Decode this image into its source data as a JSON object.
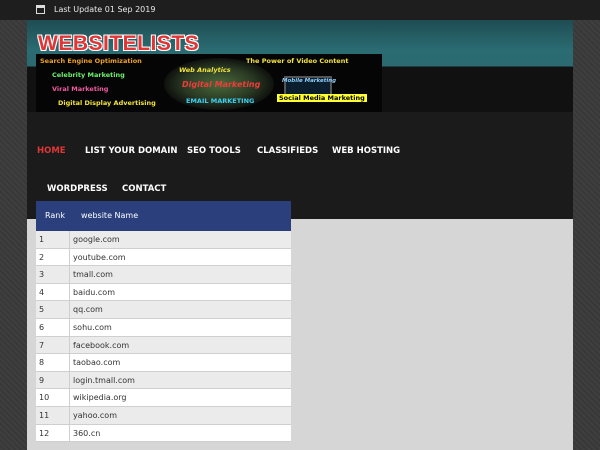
{
  "topbar": {
    "last_update": "Last Update 01 Sep 2019"
  },
  "site": {
    "title": "WEBSITELISTS"
  },
  "banner": {
    "phrases": {
      "seo": "Search Engine Optimization",
      "video": "The Power of Video Content",
      "analytics": "Web Analytics",
      "celebrity": "Celebrity Marketing",
      "digital": "Digital Marketing",
      "mobile": "Mobile Marketing",
      "viral": "Viral Marketing",
      "email": "EMAIL MARKETING",
      "social": "Social Media Marketing",
      "display": "Digital Display Advertising"
    }
  },
  "nav": {
    "home": "HOME",
    "list_domain": "LIST YOUR DOMAIN",
    "seo_tools": "SEO TOOLS",
    "classifieds": "CLASSIFIEDS",
    "web_hosting": "WEB HOSTING",
    "wordpress": "WORDPRESS",
    "contact": "CONTACT",
    "menu_icon": "hamburger-icon"
  },
  "table": {
    "headers": [
      "Rank",
      "website Name"
    ],
    "rows": [
      [
        "1",
        "google.com"
      ],
      [
        "2",
        "youtube.com"
      ],
      [
        "3",
        "tmall.com"
      ],
      [
        "4",
        "baidu.com"
      ],
      [
        "5",
        "qq.com"
      ],
      [
        "6",
        "sohu.com"
      ],
      [
        "7",
        "facebook.com"
      ],
      [
        "8",
        "taobao.com"
      ],
      [
        "9",
        "login.tmall.com"
      ],
      [
        "10",
        "wikipedia.org"
      ],
      [
        "11",
        "yahoo.com"
      ],
      [
        "12",
        "360.cn"
      ]
    ]
  },
  "colors": {
    "accent": "#e23636",
    "nav_bg": "#1b1b1b",
    "table_header": "#2a3f7c",
    "header_teal": "#2a6c72"
  }
}
